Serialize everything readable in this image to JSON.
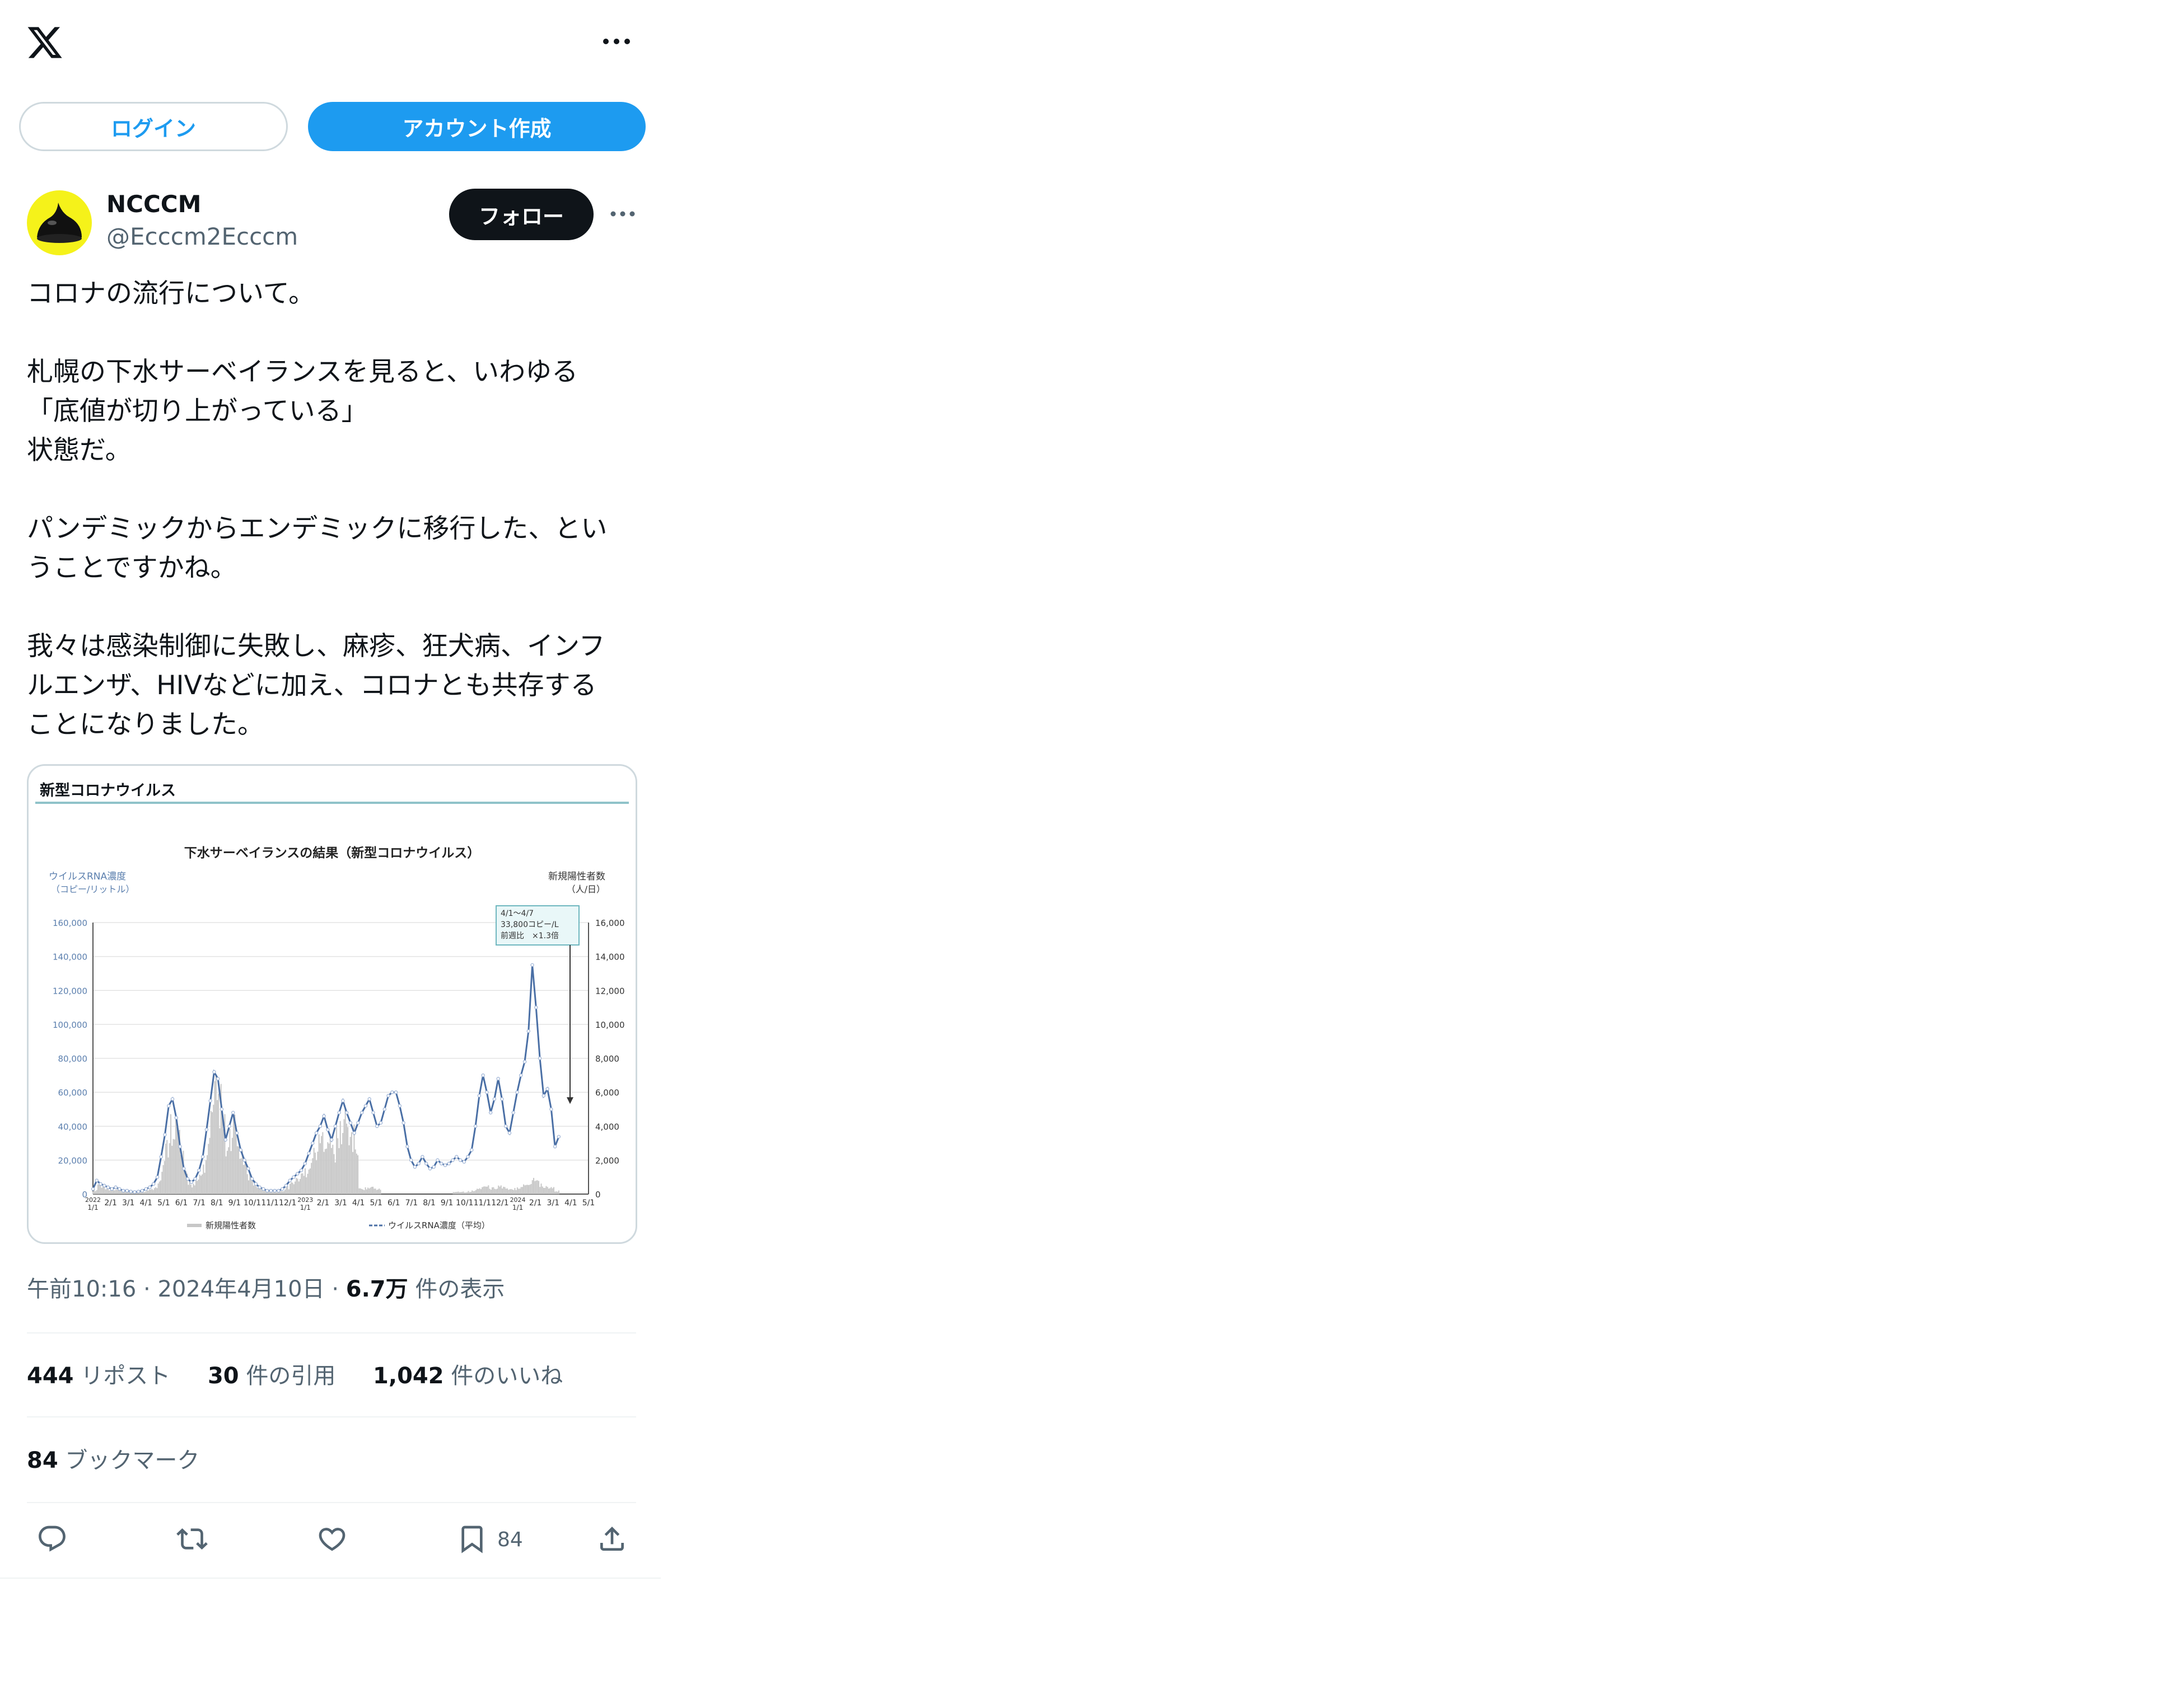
{
  "top": {
    "logo_icon": "x-logo-icon",
    "more_icon": "more-horizontal-icon"
  },
  "auth": {
    "login_label": "ログイン",
    "signup_label": "アカウント作成"
  },
  "author": {
    "name": "NCCCM",
    "handle": "@Ecccm2Ecccm",
    "follow_label": "フォロー"
  },
  "tweet": {
    "paragraphs": [
      "コロナの流行について。",
      "札幌の下水サーベイランスを見ると、いわゆる\n「底値が切り上がっている」\n状態だ。",
      "パンデミックからエンデミックに移行した、とい\nうことですかね。",
      "我々は感染制御に失敗し、麻疹、狂犬病、インフ\nルエンザ、HIVなどに加え、コロナとも共存する\nことになりました。"
    ]
  },
  "media": {
    "header": "新型コロナウイルス",
    "chart_data": {
      "type": "bar+line",
      "title": "下水サーベイランスの結果（新型コロナウイルス）",
      "ylabel_left": [
        "ウイルスRNA濃度",
        "（コピー/リットル）"
      ],
      "ylabel_right": [
        "新規陽性者数",
        "（人/日）"
      ],
      "ylim_left": [
        0,
        160000
      ],
      "ylim_right": [
        0,
        16000
      ],
      "yticks_left": [
        "160,000",
        "140,000",
        "120,000",
        "100,000",
        "80,000",
        "60,000",
        "40,000",
        "20,000",
        "0"
      ],
      "yticks_right": [
        "16,000",
        "14,000",
        "12,000",
        "10,000",
        "8,000",
        "6,000",
        "4,000",
        "2,000",
        "0"
      ],
      "xticks": [
        "2022 1/1",
        "2/1",
        "3/1",
        "4/1",
        "5/1",
        "6/1",
        "7/1",
        "8/1",
        "9/1",
        "10/1",
        "11/1",
        "12/1",
        "2023 1/1",
        "2/1",
        "3/1",
        "4/1",
        "5/1",
        "6/1",
        "7/1",
        "8/1",
        "9/1",
        "10/1",
        "11/1",
        "12/1",
        "2024 1/1",
        "2/1",
        "3/1",
        "4/1",
        "5/1"
      ],
      "annotation": [
        "4/1～4/7",
        "33,800コピー/L",
        "前週比　×1.3倍"
      ],
      "legend": [
        "新規陽性者数",
        "ウイルスRNA濃度（平均）"
      ],
      "series_rna_weekly_avg": [
        3000,
        8000,
        6000,
        5000,
        4000,
        3000,
        4000,
        3000,
        2000,
        2000,
        1500,
        1200,
        1500,
        2000,
        3000,
        4000,
        6000,
        10000,
        22000,
        35000,
        52000,
        56000,
        45000,
        28000,
        15000,
        9000,
        7000,
        9000,
        14000,
        22000,
        38000,
        55000,
        72000,
        68000,
        50000,
        32000,
        40000,
        48000,
        36000,
        26000,
        20000,
        15000,
        9000,
        6000,
        4000,
        3000,
        2000,
        2000,
        2000,
        2000,
        3000,
        5000,
        8000,
        10000,
        12000,
        14000,
        18000,
        24000,
        30000,
        36000,
        40000,
        46000,
        38000,
        32000,
        40000,
        48000,
        55000,
        48000,
        42000,
        36000,
        42000,
        48000,
        52000,
        56000,
        48000,
        40000,
        42000,
        50000,
        58000,
        60000,
        60000,
        52000,
        42000,
        28000,
        20000,
        16000,
        18000,
        22000,
        18000,
        15000,
        16000,
        20000,
        18000,
        17000,
        18000,
        20000,
        22000,
        20000,
        19000,
        22000,
        26000,
        40000,
        58000,
        70000,
        60000,
        48000,
        56000,
        68000,
        56000,
        40000,
        36000,
        48000,
        60000,
        70000,
        78000,
        96000,
        135000,
        110000,
        80000,
        58000,
        62000,
        50000,
        28000,
        33800
      ]
    }
  },
  "meta": {
    "time": "午前10:16",
    "sep": "·",
    "date": "2024年4月10日",
    "views_num": "6.7万",
    "views_label": " 件の表示"
  },
  "stats": {
    "reposts": {
      "num": "444",
      "label": " リポスト"
    },
    "quotes": {
      "num": "30",
      "label": " 件の引用"
    },
    "likes": {
      "num": "1,042",
      "label": " 件のいいね"
    },
    "bookmarks": {
      "num": "84",
      "label": " ブックマーク"
    }
  },
  "actions": {
    "reply_icon": "reply-icon",
    "retweet_icon": "retweet-icon",
    "like_icon": "heart-icon",
    "bookmark_icon": "bookmark-icon",
    "bookmark_count": "84",
    "share_icon": "share-icon"
  }
}
